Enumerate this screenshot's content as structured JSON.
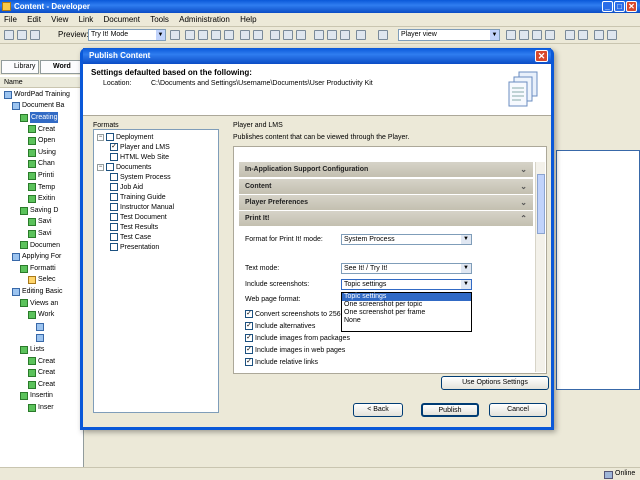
{
  "app": {
    "title": "Content - Developer"
  },
  "window_controls": {
    "minimize": "_",
    "maximize": "□",
    "close": "✕"
  },
  "menu": [
    "File",
    "Edit",
    "View",
    "Link",
    "Document",
    "Tools",
    "Administration",
    "Help"
  ],
  "toolbar": {
    "preview_label": "Preview:",
    "preview_mode": "Try It! Mode",
    "view_mode": "Player view"
  },
  "tabs": {
    "library": "Library",
    "word": "Word"
  },
  "tree": {
    "header": "Name",
    "items": [
      {
        "label": "WordPad Training",
        "indent": 0,
        "icon": "book"
      },
      {
        "label": "Document Ba",
        "indent": 1,
        "icon": "book"
      },
      {
        "label": "Creating",
        "indent": 2,
        "icon": "chk",
        "highlight": true
      },
      {
        "label": "Creat",
        "indent": 3,
        "icon": "chk"
      },
      {
        "label": "Open",
        "indent": 3,
        "icon": "chk"
      },
      {
        "label": "Using",
        "indent": 3,
        "icon": "chk"
      },
      {
        "label": "Chan",
        "indent": 3,
        "icon": "chk"
      },
      {
        "label": "Printi",
        "indent": 3,
        "icon": "chk"
      },
      {
        "label": "Temp",
        "indent": 3,
        "icon": "chk"
      },
      {
        "label": "Exitin",
        "indent": 3,
        "icon": "chk"
      },
      {
        "label": "Saving D",
        "indent": 2,
        "icon": "chk"
      },
      {
        "label": "Savi",
        "indent": 3,
        "icon": "chk"
      },
      {
        "label": "Savi",
        "indent": 3,
        "icon": "chk"
      },
      {
        "label": "Documen",
        "indent": 2,
        "icon": "chk"
      },
      {
        "label": "Applying For",
        "indent": 1,
        "icon": "book"
      },
      {
        "label": "Formatti",
        "indent": 2,
        "icon": "chk"
      },
      {
        "label": "Selec",
        "indent": 3,
        "icon": "sel"
      },
      {
        "label": "Editing Basic",
        "indent": 1,
        "icon": "book"
      },
      {
        "label": "Views an",
        "indent": 2,
        "icon": "chk"
      },
      {
        "label": "Work",
        "indent": 3,
        "icon": "chk"
      },
      {
        "label": "",
        "indent": 4,
        "icon": "doc"
      },
      {
        "label": "",
        "indent": 4,
        "icon": "doc"
      },
      {
        "label": "Lists",
        "indent": 2,
        "icon": "chk"
      },
      {
        "label": "Creat",
        "indent": 3,
        "icon": "chk"
      },
      {
        "label": "Creat",
        "indent": 3,
        "icon": "chk"
      },
      {
        "label": "Creat",
        "indent": 3,
        "icon": "chk"
      },
      {
        "label": "Insertin",
        "indent": 2,
        "icon": "chk"
      },
      {
        "label": "Inser",
        "indent": 3,
        "icon": "chk"
      }
    ]
  },
  "status": {
    "online": "Online"
  },
  "dialog": {
    "title": "Publish Content",
    "close": "✕",
    "heading": "Settings defaulted based on the following:",
    "location_label": "Location:",
    "location": "C:\\Documents and Settings\\Username\\Documents\\User Productivity Kit",
    "formats_label": "Formats",
    "formats": [
      {
        "label": "Deployment",
        "level": 0,
        "expander": "−",
        "checked": false
      },
      {
        "label": "Player and LMS",
        "level": 1,
        "checked": true
      },
      {
        "label": "HTML Web Site",
        "level": 1,
        "checked": false
      },
      {
        "label": "Documents",
        "level": 0,
        "expander": "−",
        "checked": false
      },
      {
        "label": "System Process",
        "level": 1,
        "checked": false
      },
      {
        "label": "Job Aid",
        "level": 1,
        "checked": false
      },
      {
        "label": "Training Guide",
        "level": 1,
        "checked": false
      },
      {
        "label": "Instructor Manual",
        "level": 1,
        "checked": false
      },
      {
        "label": "Test Document",
        "level": 1,
        "checked": false
      },
      {
        "label": "Test Results",
        "level": 1,
        "checked": false
      },
      {
        "label": "Test Case",
        "level": 1,
        "checked": false
      },
      {
        "label": "Presentation",
        "level": 1,
        "checked": false
      }
    ],
    "panel_title": "Player and LMS",
    "panel_desc": "Publishes content that can be viewed through the Player.",
    "sections": [
      "In-Application Support Configuration",
      "Content",
      "Player Preferences",
      "Print It!"
    ],
    "print_it": {
      "format_label": "Format for Print It! mode:",
      "format_value": "System Process",
      "text_mode_label": "Text mode:",
      "text_mode_value": "See It! / Try It!",
      "screenshots_label": "Include screenshots:",
      "screenshots_value": "Topic settings",
      "web_format_label": "Web page format:",
      "checkboxes": [
        {
          "label": "Convert screenshots to 256",
          "checked": true
        },
        {
          "label": "Include alternatives",
          "checked": true
        },
        {
          "label": "Include images from packages",
          "checked": true
        },
        {
          "label": "Include images in web pages",
          "checked": true
        },
        {
          "label": "Include relative links",
          "checked": true
        }
      ]
    },
    "dropdown_options": [
      "Topic settings",
      "One screenshot per topic",
      "One screenshot per frame",
      "None"
    ],
    "use_options_button": "Use Options Settings",
    "back_button": "< Back",
    "publish_button": "Publish",
    "cancel_button": "Cancel"
  }
}
